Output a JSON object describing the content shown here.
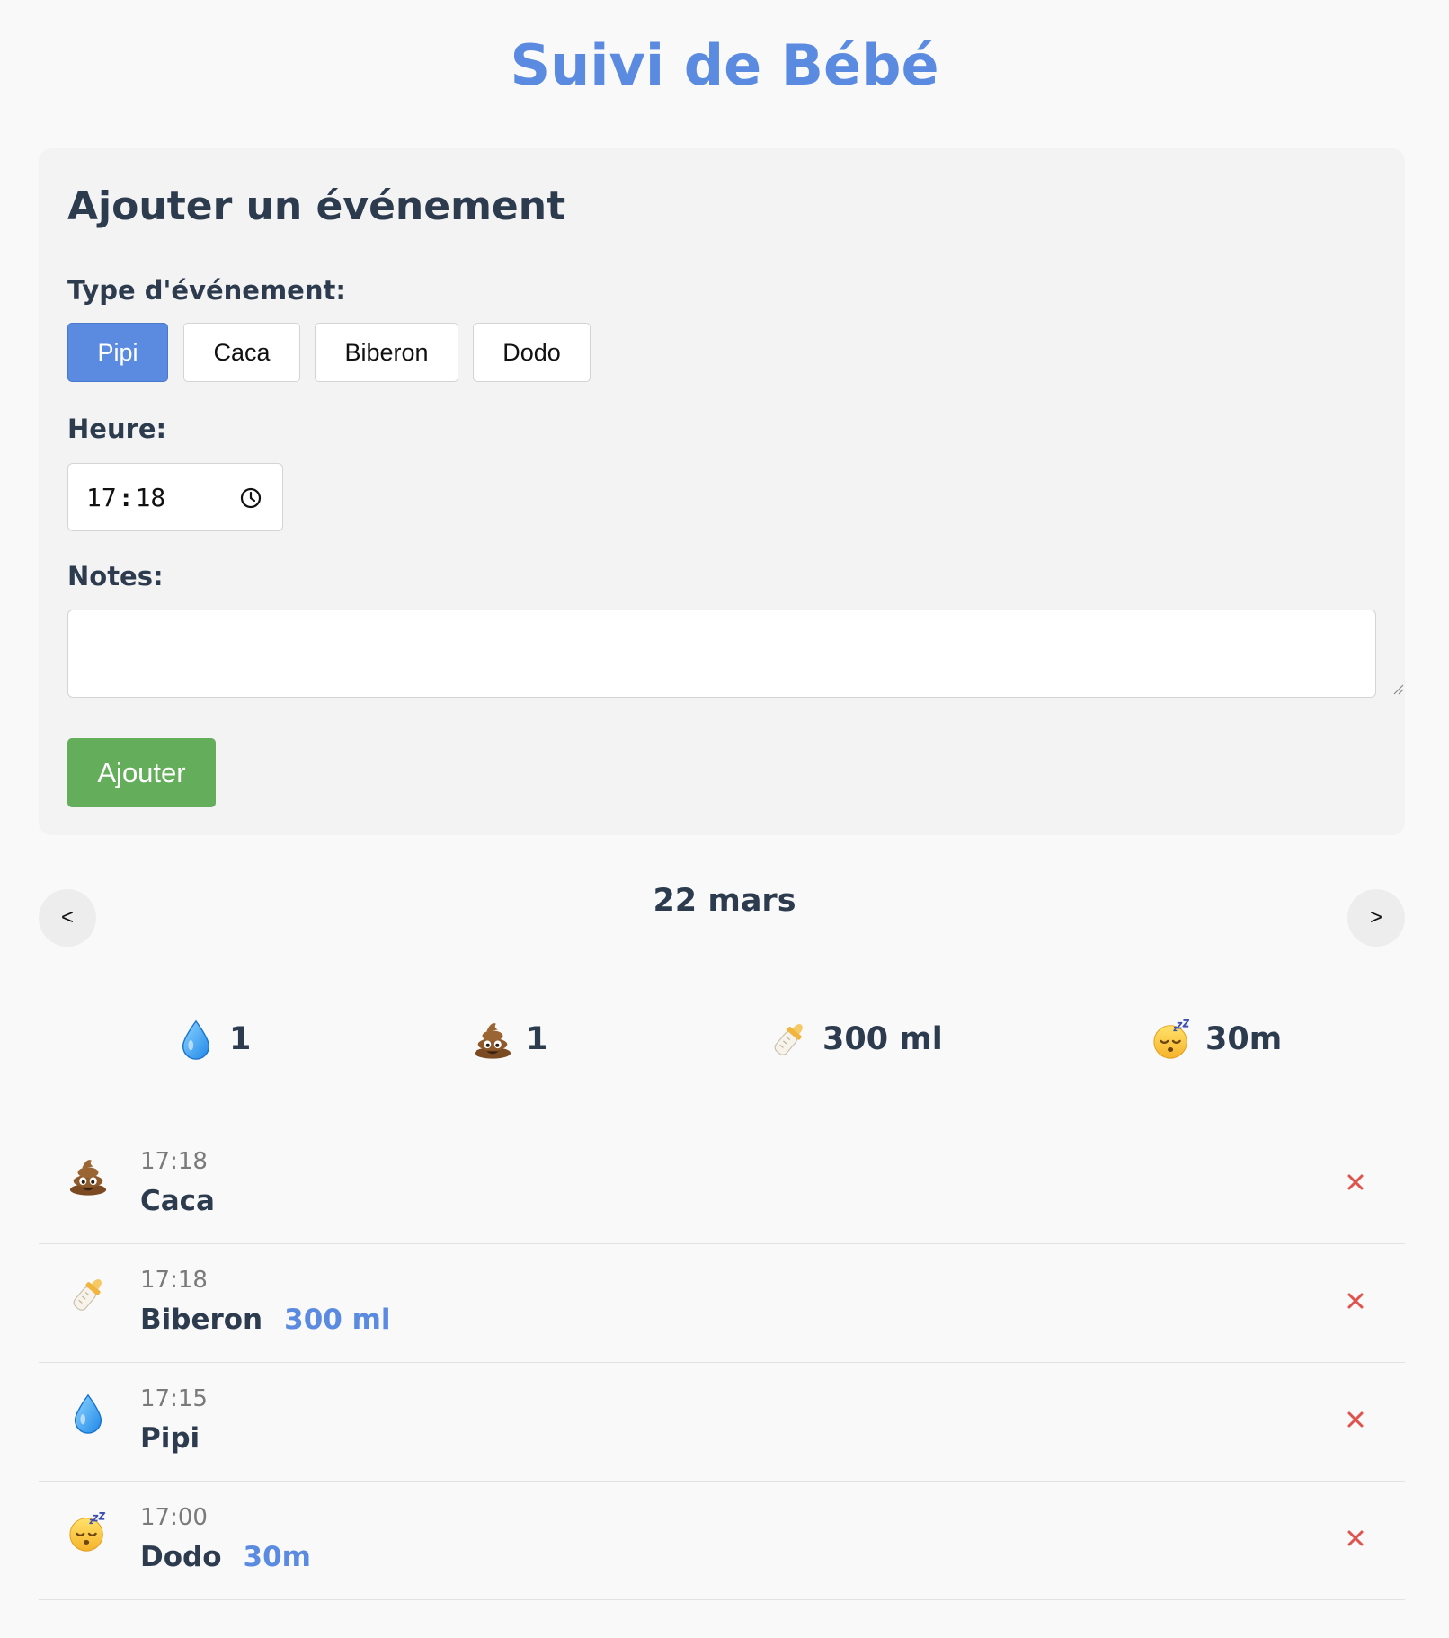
{
  "app": {
    "title": "Suivi de Bébé"
  },
  "form": {
    "title": "Ajouter un événement",
    "type_label": "Type d'événement:",
    "types": [
      {
        "label": "Pipi",
        "active": true
      },
      {
        "label": "Caca",
        "active": false
      },
      {
        "label": "Biberon",
        "active": false
      },
      {
        "label": "Dodo",
        "active": false
      }
    ],
    "time_label": "Heure:",
    "time_hours": "17",
    "time_minutes": "18",
    "notes_label": "Notes:",
    "notes_value": "",
    "submit_label": "Ajouter"
  },
  "day_nav": {
    "prev_label": "<",
    "next_label": ">",
    "date": "22 mars"
  },
  "summary": [
    {
      "icon": "droplet-icon",
      "value": "1"
    },
    {
      "icon": "poop-icon",
      "value": "1"
    },
    {
      "icon": "baby-bottle-icon",
      "value": "300 ml"
    },
    {
      "icon": "sleeping-face-icon",
      "value": "30m"
    }
  ],
  "events": [
    {
      "icon": "poop-icon",
      "time": "17:18",
      "label": "Caca",
      "detail": ""
    },
    {
      "icon": "baby-bottle-icon",
      "time": "17:18",
      "label": "Biberon",
      "detail": "300 ml"
    },
    {
      "icon": "droplet-icon",
      "time": "17:15",
      "label": "Pipi",
      "detail": ""
    },
    {
      "icon": "sleeping-face-icon",
      "time": "17:00",
      "label": "Dodo",
      "detail": "30m"
    }
  ],
  "delete_symbol": "×",
  "colors": {
    "accent": "#5b8be0",
    "success": "#63ad5b",
    "danger": "#e0524d",
    "text": "#2d3b4f",
    "background": "#f9f9f9"
  }
}
